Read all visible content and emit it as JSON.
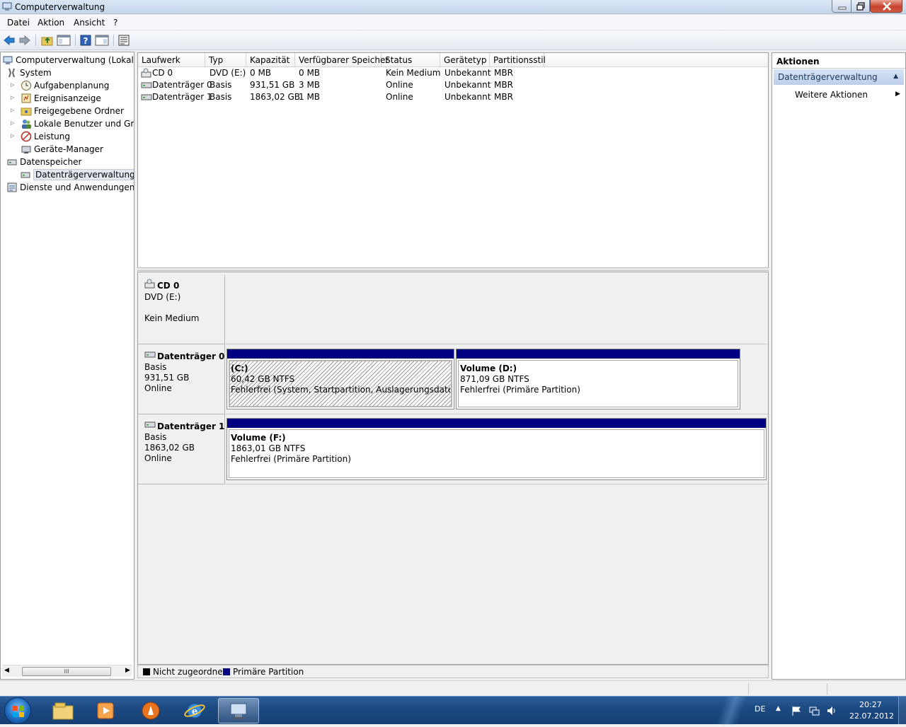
{
  "window": {
    "title": "Computerverwaltung"
  },
  "menu": [
    "Datei",
    "Aktion",
    "Ansicht",
    "?"
  ],
  "toolbar": [
    "back-icon",
    "forward-icon",
    "up-folder-icon",
    "show-hide-tree-icon",
    "help-icon",
    "show-hide-action-pane-icon",
    "properties-icon"
  ],
  "tree": {
    "root": "Computerverwaltung (Lokal)",
    "system": "System",
    "system_items": [
      "Aufgabenplanung",
      "Ereignisanzeige",
      "Freigegebene Ordner",
      "Lokale Benutzer und Gruppen",
      "Leistung",
      "Geräte-Manager"
    ],
    "storage": "Datenspeicher",
    "storage_items": [
      "Datenträgerverwaltung"
    ],
    "services": "Dienste und Anwendungen",
    "scrollbar_thumb": "III"
  },
  "volume_list": {
    "columns": [
      "Laufwerk",
      "Typ",
      "Kapazität",
      "Verfügbarer Speicher",
      "Status",
      "Gerätetyp",
      "Partitionsstil"
    ],
    "rows": [
      [
        "CD 0",
        "DVD (E:)",
        "0 MB",
        "0 MB",
        "Kein Medium",
        "Unbekannt",
        "MBR"
      ],
      [
        "Datenträger 0",
        "Basis",
        "931,51 GB",
        "3 MB",
        "Online",
        "Unbekannt",
        "MBR"
      ],
      [
        "Datenträger 1",
        "Basis",
        "1863,02 GB",
        "1 MB",
        "Online",
        "Unbekannt",
        "MBR"
      ]
    ]
  },
  "disks": {
    "cd0": {
      "name": "CD 0",
      "type": "DVD (E:)",
      "status": "Kein Medium"
    },
    "disk0": {
      "name": "Datenträger 0",
      "type": "Basis",
      "size": "931,51 GB",
      "status": "Online",
      "partitions": [
        {
          "label": "(C:)",
          "size": "60,42 GB NTFS",
          "status": "Fehlerfrei (System, Startpartition, Auslagerungsdatei, Aktiv,"
        },
        {
          "label": "Volume  (D:)",
          "size": "871,09 GB NTFS",
          "status": "Fehlerfrei (Primäre Partition)"
        }
      ]
    },
    "disk1": {
      "name": "Datenträger 1",
      "type": "Basis",
      "size": "1863,02 GB",
      "status": "Online",
      "partitions": [
        {
          "label": "Volume  (F:)",
          "size": "1863,01 GB NTFS",
          "status": "Fehlerfrei (Primäre Partition)"
        }
      ]
    }
  },
  "legend": {
    "unallocated": {
      "label": "Nicht zugeordnet",
      "color": "#000000"
    },
    "primary": {
      "label": "Primäre Partition",
      "color": "#000080"
    }
  },
  "actions": {
    "title": "Aktionen",
    "section": "Datenträgerverwaltung",
    "more": "Weitere Aktionen"
  },
  "taskbar": {
    "language": "DE",
    "time": "20:27",
    "date": "22.07.2012",
    "apps": [
      "explorer-icon",
      "media-player-icon",
      "vlc-icon",
      "internet-explorer-icon",
      "computer-management-icon"
    ]
  },
  "colors": {
    "primary_partition": "#000080",
    "selection": "#c4d6ec"
  }
}
